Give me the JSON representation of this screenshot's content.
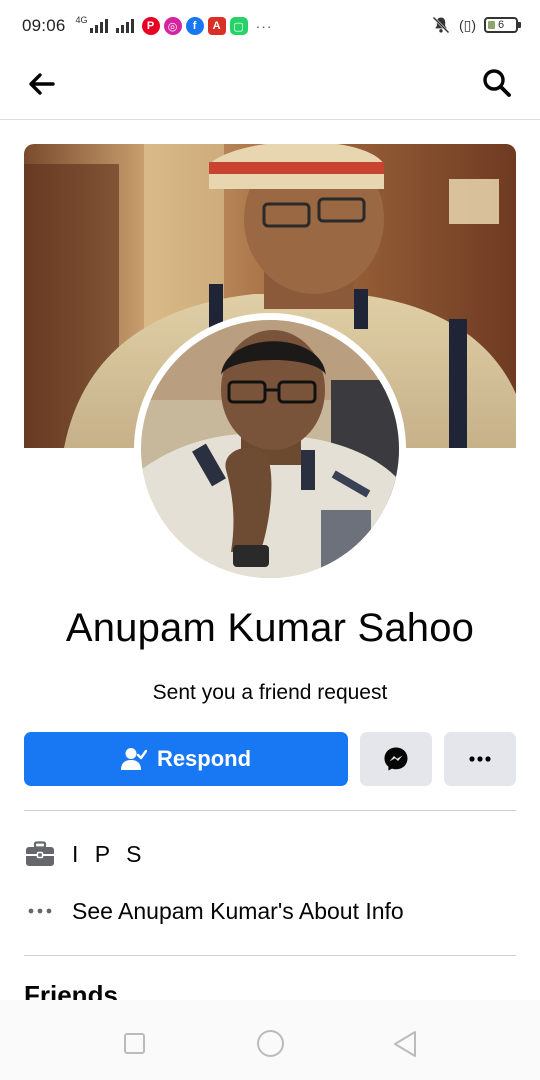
{
  "status_bar": {
    "time": "09:06",
    "network": "4G",
    "battery": "6",
    "more": "···"
  },
  "nav": {
    "back_icon": "arrow-left-icon",
    "search_icon": "search-icon"
  },
  "profile": {
    "name": "Anupam Kumar Sahoo",
    "status": "Sent you a friend request"
  },
  "actions": {
    "respond_label": "Respond",
    "messenger_icon": "messenger-icon",
    "more_icon": "more-dots-icon"
  },
  "info": {
    "occupation": "I P S",
    "about_link": "See Anupam Kumar's About Info"
  },
  "friends": {
    "title": "Friends"
  },
  "colors": {
    "accent": "#1877f2",
    "button_gray": "#e4e6eb",
    "divider": "#ced0d4"
  }
}
